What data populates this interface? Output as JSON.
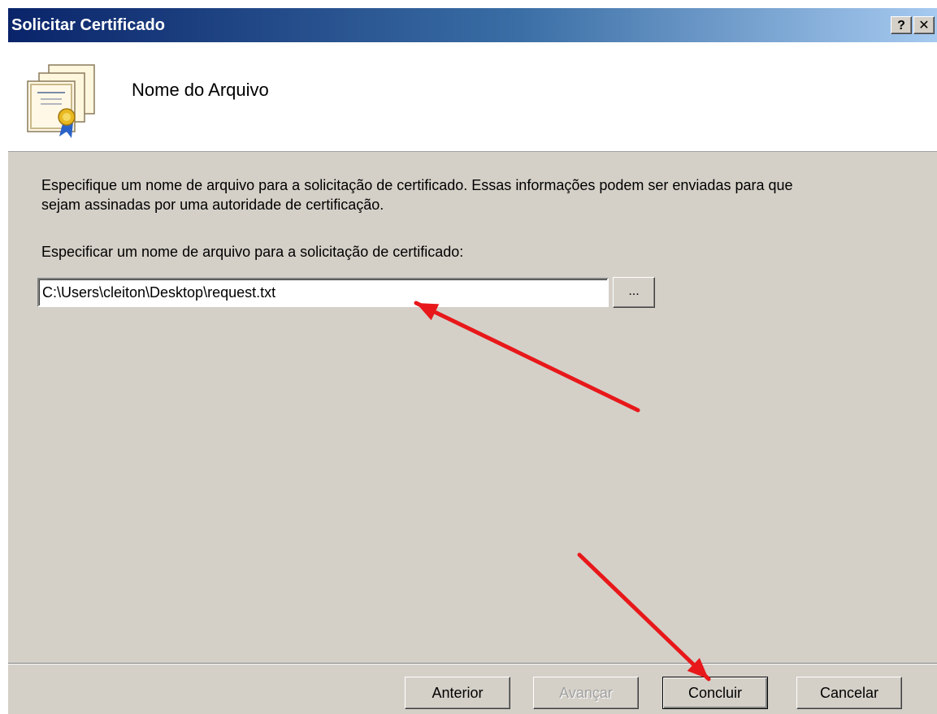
{
  "window": {
    "title": "Solicitar Certificado",
    "help_label": "?",
    "close_label": "✕"
  },
  "header": {
    "title": "Nome do Arquivo",
    "icon": "certificate-icon"
  },
  "body": {
    "description": "Especifique um nome de arquivo para a solicitação de certificado. Essas informações podem ser enviadas para que sejam assinadas por uma autoridade de certificação.",
    "field_label": "Especificar um nome de arquivo para a solicitação de certificado:",
    "filename_value": "C:\\Users\\cleiton\\Desktop\\request.txt",
    "browse_label": "..."
  },
  "footer": {
    "back_label": "Anterior",
    "next_label": "Avançar",
    "finish_label": "Concluir",
    "cancel_label": "Cancelar"
  },
  "annotations": {
    "arrow_color": "#e8181a"
  }
}
